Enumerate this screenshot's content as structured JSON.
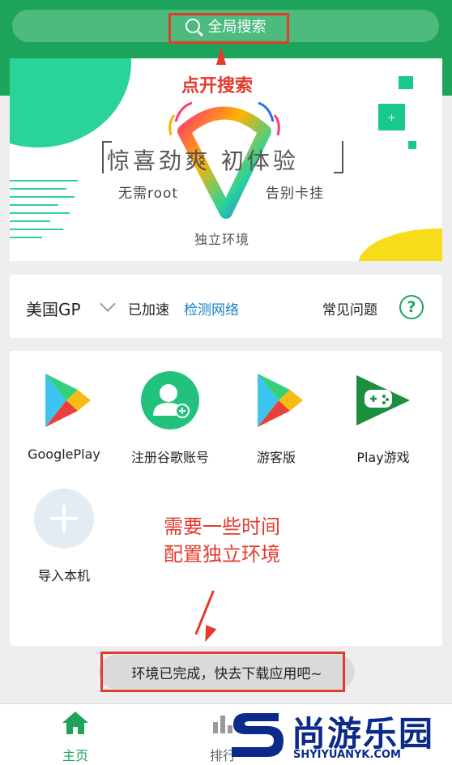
{
  "search": {
    "label": "全局搜索"
  },
  "annotations": {
    "tap_search": "点开搜索",
    "wait_line1": "需要一些时间",
    "wait_line2": "配置独立环境"
  },
  "banner": {
    "headline": "惊喜劲爽  初体验",
    "left_tag": "无需root",
    "right_tag": "告别卡挂",
    "bottom_tag": "独立环境"
  },
  "network": {
    "region": "美国GP",
    "status": "已加速",
    "check_link": "检测网络",
    "faq": "常见问题",
    "help_symbol": "?"
  },
  "apps": [
    {
      "label": "GooglePlay",
      "icon": "google-play-icon"
    },
    {
      "label": "注册谷歌账号",
      "icon": "register-account-icon"
    },
    {
      "label": "游客版",
      "icon": "google-play-icon"
    },
    {
      "label": "Play游戏",
      "icon": "play-games-icon"
    },
    {
      "label": "导入本机",
      "icon": "plus-icon"
    }
  ],
  "status_message": "环境已完成，快去下载应用吧~",
  "tabs": [
    {
      "label": "主页",
      "icon": "home-icon",
      "active": true
    },
    {
      "label": "排行",
      "icon": "ranking-icon",
      "active": false
    }
  ],
  "watermark": {
    "brand": "尚游乐园",
    "url": "SHYIYUANYK.COM"
  },
  "colors": {
    "primary": "#1ea35b",
    "annotation": "#e53a2c",
    "link": "#1a7fc4"
  }
}
